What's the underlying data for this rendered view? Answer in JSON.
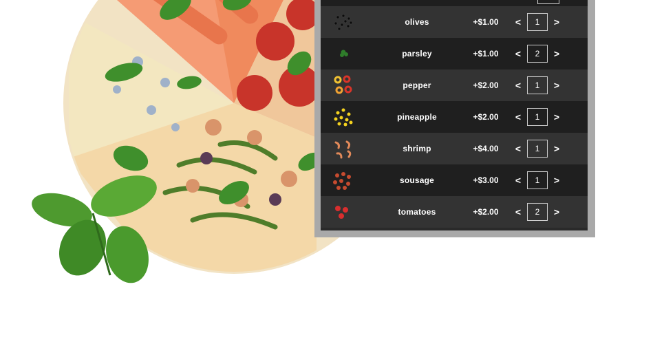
{
  "toppings": [
    {
      "name": "olives",
      "price": "+$1.00",
      "qty": "1",
      "icon": "olives-icon",
      "colors": [
        "#0b0b0b"
      ]
    },
    {
      "name": "parsley",
      "price": "+$1.00",
      "qty": "2",
      "icon": "parsley-icon",
      "colors": [
        "#2f7d2b"
      ]
    },
    {
      "name": "pepper",
      "price": "+$2.00",
      "qty": "1",
      "icon": "pepper-icon",
      "colors": [
        "#d9352a",
        "#f1c232"
      ]
    },
    {
      "name": "pineapple",
      "price": "+$2.00",
      "qty": "1",
      "icon": "pineapple-icon",
      "colors": [
        "#f4d21f"
      ]
    },
    {
      "name": "shrimp",
      "price": "+$4.00",
      "qty": "1",
      "icon": "shrimp-icon",
      "colors": [
        "#e28a5a"
      ]
    },
    {
      "name": "sousage",
      "price": "+$3.00",
      "qty": "1",
      "icon": "sausage-icon",
      "colors": [
        "#c64b2f"
      ]
    },
    {
      "name": "tomatoes",
      "price": "+$2.00",
      "qty": "2",
      "icon": "tomatoes-icon",
      "colors": [
        "#d82e2e"
      ]
    }
  ],
  "controls": {
    "decrement": "<",
    "increment": ">"
  }
}
